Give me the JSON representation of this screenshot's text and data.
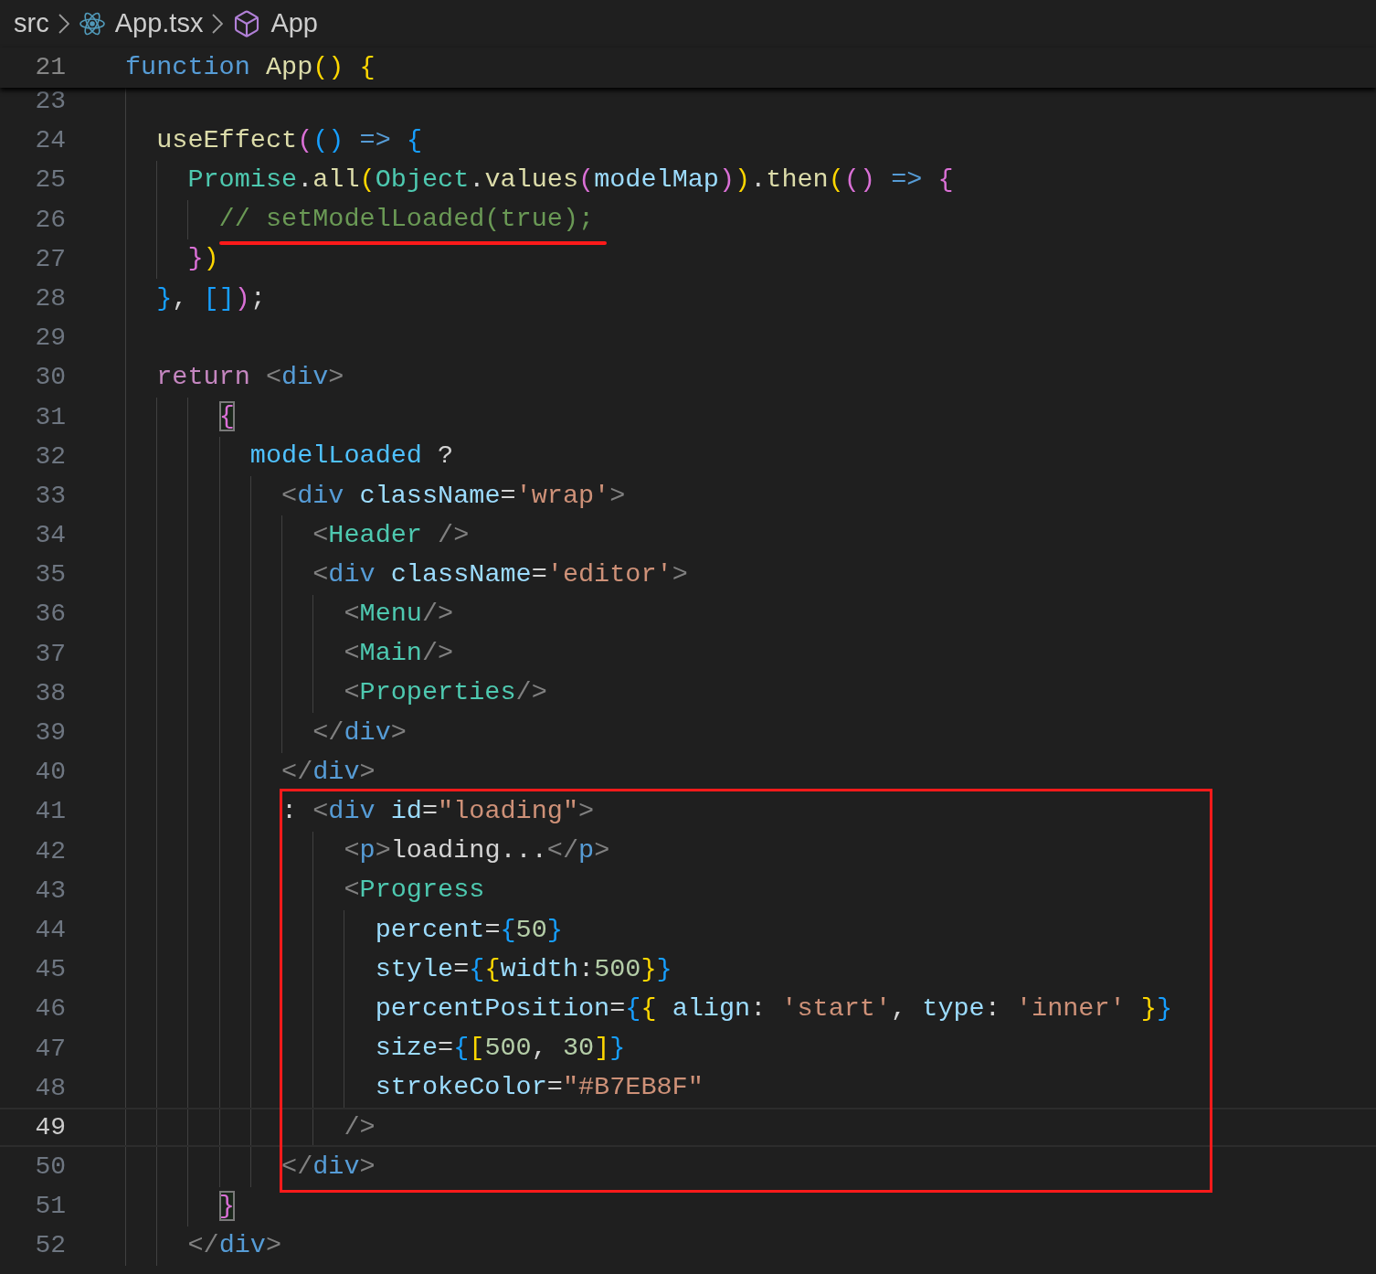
{
  "breadcrumb": [
    {
      "label": "src",
      "kind": "folder"
    },
    {
      "label": "App.tsx",
      "kind": "react-file"
    },
    {
      "label": "App",
      "kind": "symbol"
    }
  ],
  "sticky_line": {
    "number": "21",
    "tokens": [
      {
        "text": "function",
        "kind": "kw"
      },
      {
        "text": " App",
        "kind": "fn"
      },
      {
        "text": "()",
        "kind": "b1"
      },
      {
        "text": " {",
        "kind": "b1"
      }
    ]
  },
  "lines": [
    {
      "number": "23",
      "current": false
    },
    {
      "number": "24",
      "current": false,
      "tokens": [
        {
          "text": "  useEffect",
          "kind": "fn"
        },
        {
          "text": "(",
          "kind": "b2"
        },
        {
          "text": "()",
          "kind": "b3"
        },
        {
          "text": " => ",
          "kind": "kw"
        },
        {
          "text": "{",
          "kind": "b3"
        }
      ]
    },
    {
      "number": "25",
      "current": false,
      "tokens": [
        {
          "text": "    Promise",
          "kind": "type"
        },
        {
          "text": ".",
          "kind": "p"
        },
        {
          "text": "all",
          "kind": "fn"
        },
        {
          "text": "(",
          "kind": "b1"
        },
        {
          "text": "Object",
          "kind": "type"
        },
        {
          "text": ".",
          "kind": "p"
        },
        {
          "text": "values",
          "kind": "fn"
        },
        {
          "text": "(",
          "kind": "b2"
        },
        {
          "text": "modelMap",
          "kind": "var"
        },
        {
          "text": ")",
          "kind": "b2"
        },
        {
          "text": ")",
          "kind": "b1"
        },
        {
          "text": ".",
          "kind": "p"
        },
        {
          "text": "then",
          "kind": "fn"
        },
        {
          "text": "(",
          "kind": "b1"
        },
        {
          "text": "()",
          "kind": "b2"
        },
        {
          "text": " => ",
          "kind": "kw"
        },
        {
          "text": "{",
          "kind": "b2"
        }
      ]
    },
    {
      "number": "26",
      "current": false,
      "underlined": true,
      "tokens": [
        {
          "text": "      // setModelLoaded(true);",
          "kind": "comment"
        }
      ]
    },
    {
      "number": "27",
      "current": false,
      "tokens": [
        {
          "text": "    }",
          "kind": "b2"
        },
        {
          "text": ")",
          "kind": "b1"
        }
      ]
    },
    {
      "number": "28",
      "current": false,
      "tokens": [
        {
          "text": "  }",
          "kind": "b3"
        },
        {
          "text": ", ",
          "kind": "p"
        },
        {
          "text": "[]",
          "kind": "b3"
        },
        {
          "text": ")",
          "kind": "b2"
        },
        {
          "text": ";",
          "kind": "p"
        }
      ]
    },
    {
      "number": "29",
      "current": false
    },
    {
      "number": "30",
      "current": false,
      "tokens": [
        {
          "text": "  return ",
          "kind": "ctrl"
        },
        {
          "text": "<",
          "kind": "tagp"
        },
        {
          "text": "div",
          "kind": "tag"
        },
        {
          "text": ">",
          "kind": "tagp"
        }
      ]
    },
    {
      "number": "31",
      "current": false,
      "tokens": [
        {
          "text": "      {",
          "kind": "b2match"
        }
      ]
    },
    {
      "number": "32",
      "current": false,
      "tokens": [
        {
          "text": "        modelLoaded",
          "kind": "const"
        },
        {
          "text": " ?",
          "kind": "p"
        }
      ]
    },
    {
      "number": "33",
      "current": false,
      "tokens": [
        {
          "text": "          <",
          "kind": "tagp"
        },
        {
          "text": "div",
          "kind": "tag"
        },
        {
          "text": " className",
          "kind": "attr"
        },
        {
          "text": "=",
          "kind": "p"
        },
        {
          "text": "'wrap'",
          "kind": "str"
        },
        {
          "text": ">",
          "kind": "tagp"
        }
      ]
    },
    {
      "number": "34",
      "current": false,
      "tokens": [
        {
          "text": "            <",
          "kind": "tagp"
        },
        {
          "text": "Header",
          "kind": "type"
        },
        {
          "text": " />",
          "kind": "tagp"
        }
      ]
    },
    {
      "number": "35",
      "current": false,
      "tokens": [
        {
          "text": "            <",
          "kind": "tagp"
        },
        {
          "text": "div",
          "kind": "tag"
        },
        {
          "text": " className",
          "kind": "attr"
        },
        {
          "text": "=",
          "kind": "p"
        },
        {
          "text": "'editor'",
          "kind": "str"
        },
        {
          "text": ">",
          "kind": "tagp"
        }
      ]
    },
    {
      "number": "36",
      "current": false,
      "tokens": [
        {
          "text": "              <",
          "kind": "tagp"
        },
        {
          "text": "Menu",
          "kind": "type"
        },
        {
          "text": "/>",
          "kind": "tagp"
        }
      ]
    },
    {
      "number": "37",
      "current": false,
      "tokens": [
        {
          "text": "              <",
          "kind": "tagp"
        },
        {
          "text": "Main",
          "kind": "type"
        },
        {
          "text": "/>",
          "kind": "tagp"
        }
      ]
    },
    {
      "number": "38",
      "current": false,
      "tokens": [
        {
          "text": "              <",
          "kind": "tagp"
        },
        {
          "text": "Properties",
          "kind": "type"
        },
        {
          "text": "/>",
          "kind": "tagp"
        }
      ]
    },
    {
      "number": "39",
      "current": false,
      "tokens": [
        {
          "text": "            </",
          "kind": "tagp"
        },
        {
          "text": "div",
          "kind": "tag"
        },
        {
          "text": ">",
          "kind": "tagp"
        }
      ]
    },
    {
      "number": "40",
      "current": false,
      "tokens": [
        {
          "text": "          </",
          "kind": "tagp"
        },
        {
          "text": "div",
          "kind": "tag"
        },
        {
          "text": ">",
          "kind": "tagp"
        }
      ]
    },
    {
      "number": "41",
      "current": false,
      "tokens": [
        {
          "text": "          : ",
          "kind": "p"
        },
        {
          "text": "<",
          "kind": "tagp"
        },
        {
          "text": "div",
          "kind": "tag"
        },
        {
          "text": " id",
          "kind": "attr"
        },
        {
          "text": "=",
          "kind": "p"
        },
        {
          "text": "\"loading\"",
          "kind": "str"
        },
        {
          "text": ">",
          "kind": "tagp"
        }
      ]
    },
    {
      "number": "42",
      "current": false,
      "tokens": [
        {
          "text": "              <",
          "kind": "tagp"
        },
        {
          "text": "p",
          "kind": "tag"
        },
        {
          "text": ">",
          "kind": "tagp"
        },
        {
          "text": "loading...",
          "kind": "p"
        },
        {
          "text": "</",
          "kind": "tagp"
        },
        {
          "text": "p",
          "kind": "tag"
        },
        {
          "text": ">",
          "kind": "tagp"
        }
      ]
    },
    {
      "number": "43",
      "current": false,
      "tokens": [
        {
          "text": "              <",
          "kind": "tagp"
        },
        {
          "text": "Progress",
          "kind": "type"
        }
      ]
    },
    {
      "number": "44",
      "current": false,
      "tokens": [
        {
          "text": "                percent",
          "kind": "attr"
        },
        {
          "text": "=",
          "kind": "p"
        },
        {
          "text": "{",
          "kind": "b3"
        },
        {
          "text": "50",
          "kind": "num"
        },
        {
          "text": "}",
          "kind": "b3"
        }
      ]
    },
    {
      "number": "45",
      "current": false,
      "tokens": [
        {
          "text": "                style",
          "kind": "attr"
        },
        {
          "text": "=",
          "kind": "p"
        },
        {
          "text": "{",
          "kind": "b3"
        },
        {
          "text": "{",
          "kind": "b1"
        },
        {
          "text": "width",
          "kind": "attr"
        },
        {
          "text": ":",
          "kind": "p"
        },
        {
          "text": "500",
          "kind": "num"
        },
        {
          "text": "}",
          "kind": "b1"
        },
        {
          "text": "}",
          "kind": "b3"
        }
      ]
    },
    {
      "number": "46",
      "current": false,
      "tokens": [
        {
          "text": "                percentPosition",
          "kind": "attr"
        },
        {
          "text": "=",
          "kind": "p"
        },
        {
          "text": "{",
          "kind": "b3"
        },
        {
          "text": "{ ",
          "kind": "b1"
        },
        {
          "text": "align",
          "kind": "attr"
        },
        {
          "text": ": ",
          "kind": "p"
        },
        {
          "text": "'start'",
          "kind": "str"
        },
        {
          "text": ", ",
          "kind": "p"
        },
        {
          "text": "type",
          "kind": "attr"
        },
        {
          "text": ": ",
          "kind": "p"
        },
        {
          "text": "'inner'",
          "kind": "str"
        },
        {
          "text": " }",
          "kind": "b1"
        },
        {
          "text": "}",
          "kind": "b3"
        }
      ]
    },
    {
      "number": "47",
      "current": false,
      "tokens": [
        {
          "text": "                size",
          "kind": "attr"
        },
        {
          "text": "=",
          "kind": "p"
        },
        {
          "text": "{",
          "kind": "b3"
        },
        {
          "text": "[",
          "kind": "b1"
        },
        {
          "text": "500",
          "kind": "num"
        },
        {
          "text": ", ",
          "kind": "p"
        },
        {
          "text": "30",
          "kind": "num"
        },
        {
          "text": "]",
          "kind": "b1"
        },
        {
          "text": "}",
          "kind": "b3"
        }
      ]
    },
    {
      "number": "48",
      "current": false,
      "tokens": [
        {
          "text": "                strokeColor",
          "kind": "attr"
        },
        {
          "text": "=",
          "kind": "p"
        },
        {
          "text": "\"#B7EB8F\"",
          "kind": "str"
        }
      ]
    },
    {
      "number": "49",
      "current": true,
      "tokens": [
        {
          "text": "              />",
          "kind": "tagp"
        }
      ]
    },
    {
      "number": "50",
      "current": false,
      "tokens": [
        {
          "text": "          </",
          "kind": "tagp"
        },
        {
          "text": "div",
          "kind": "tag"
        },
        {
          "text": ">",
          "kind": "tagp"
        }
      ]
    },
    {
      "number": "51",
      "current": false,
      "tokens": [
        {
          "text": "      }",
          "kind": "b2match"
        }
      ]
    },
    {
      "number": "52",
      "current": false,
      "tokens": [
        {
          "text": "    </",
          "kind": "tagp"
        },
        {
          "text": "div",
          "kind": "tag"
        },
        {
          "text": ">",
          "kind": "tagp"
        }
      ]
    }
  ]
}
